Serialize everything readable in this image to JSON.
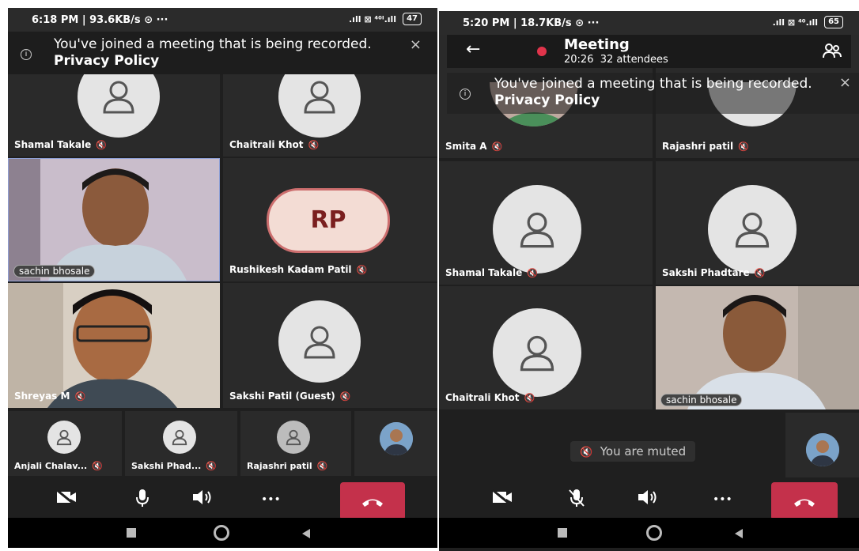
{
  "left": {
    "status": {
      "time": "6:18 PM | 93.6KB/s ⊙ ···",
      "network": ".ıll ⊠ ⁴⁰ᴵ.ıll",
      "battery": "47"
    },
    "banner": {
      "text": "You've joined a meeting that is being recorded. ",
      "link": "Privacy Policy"
    },
    "participants": [
      "Shamal Takale",
      "Chaitrali Khot",
      "sachin bhosale",
      "Rushikesh Kadam Patil",
      "Shreyas M",
      "Sakshi Patil (Guest)"
    ],
    "rp_initials": "RP",
    "bottom_row": [
      "Anjali Chalav...",
      "Sakshi Phad...",
      "Rajashri patil"
    ]
  },
  "right": {
    "status": {
      "time": "5:20 PM | 18.7KB/s ⊙ ···",
      "network": ".ıll ⊠ ⁴⁰.ıll",
      "battery": "65"
    },
    "header": {
      "title": "Meeting",
      "duration": "20:26",
      "attendees": "32 attendees"
    },
    "banner": {
      "text": "You've joined a meeting that is being recorded. ",
      "link": "Privacy Policy"
    },
    "participants": [
      "Smita A",
      "Rajashri patil",
      "Shamal Takale",
      "Sakshi Phadtare",
      "Chaitrali Khot",
      "sachin bhosale"
    ],
    "muted_text": "You are muted"
  },
  "icons": {
    "mic_off": "🎙̸",
    "close": "×",
    "back": "←",
    "more": "•••"
  },
  "colors": {
    "hangup": "#c4314b",
    "record_dot": "#e0344b"
  }
}
